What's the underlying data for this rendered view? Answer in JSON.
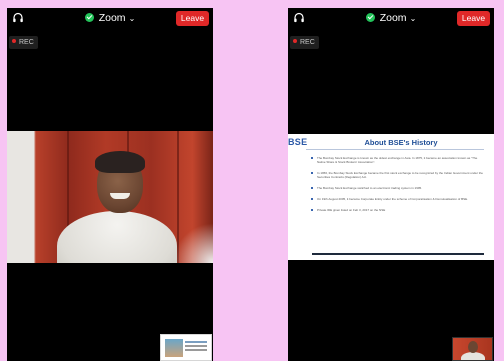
{
  "meeting": {
    "title": "Zoom",
    "leave_label": "Leave",
    "rec_label": "REC"
  },
  "icons": {
    "audio": "headphones-icon",
    "security": "shield-check-icon",
    "dropdown": "chevron-down-icon"
  },
  "colors": {
    "leave": "#e02828",
    "secure": "#23c35a",
    "background": "#000000"
  },
  "slide": {
    "logo": "BSE",
    "title": "About BSE's History",
    "bullets": [
      "The Bombay Stock Exchange is known as the oldest exchange in Asia. In 1875, it became an association known as \"The Native Share & Stock Brokers' Association\".",
      "In 1956, the Bombay Stock Exchange became the first stock exchange to be recognized by the Indian Government under the Securities Contracts (Regulation) Act.",
      "The Bombay Stock Exchange switched to an electronic trading system in 1995.",
      "On 19th August 2005, it became Corporate Entity under the scheme of Corporatisation & Demutualisation of BSE.",
      "Private IDE given listed on Feb 3, 2017 on the NSE"
    ]
  }
}
